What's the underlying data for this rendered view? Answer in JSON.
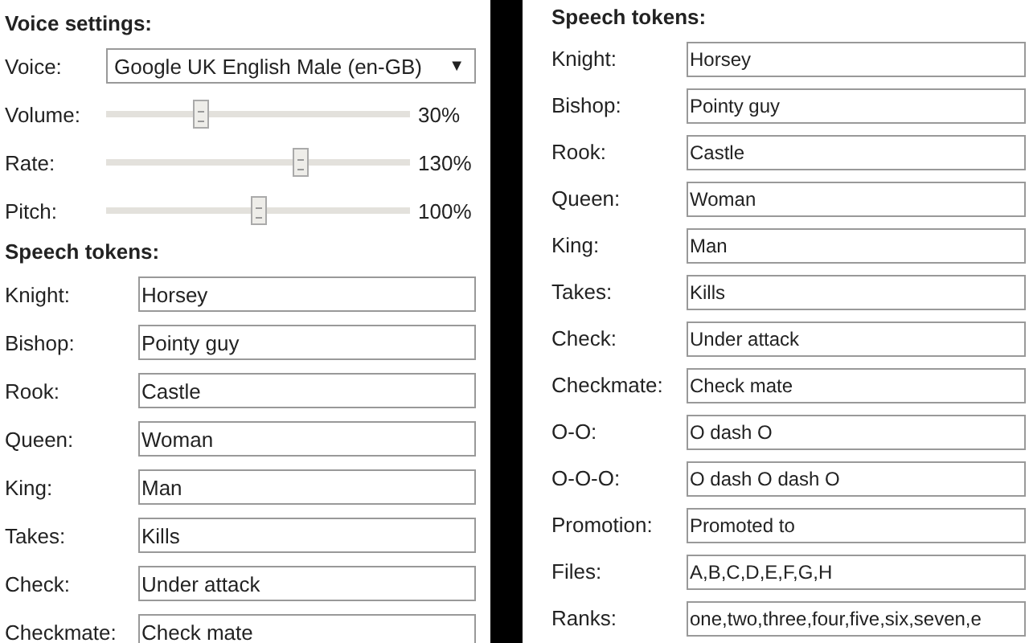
{
  "left_panel": {
    "voice_settings": {
      "heading": "Voice settings:",
      "voice": {
        "label": "Voice:",
        "value": "Google UK English Male (en-GB)",
        "arrow": "▼"
      },
      "sliders": [
        {
          "label": "Volume:",
          "level": 0.31,
          "reading": "30%"
        },
        {
          "label": "Rate:",
          "level": 0.64,
          "reading": "130%"
        },
        {
          "label": "Pitch:",
          "level": 0.5,
          "reading": "100%"
        }
      ]
    },
    "speech_tokens": {
      "heading": "Speech tokens:",
      "tokens": [
        {
          "label": "Knight:",
          "value": "Horsey"
        },
        {
          "label": "Bishop:",
          "value": "Pointy guy"
        },
        {
          "label": "Rook:",
          "value": "Castle"
        },
        {
          "label": "Queen:",
          "value": "Woman"
        },
        {
          "label": "King:",
          "value": "Man"
        },
        {
          "label": "Takes:",
          "value": "Kills"
        },
        {
          "label": "Check:",
          "value": "Under attack"
        },
        {
          "label": "Checkmate:",
          "value": "Check mate"
        }
      ]
    }
  },
  "right_panel": {
    "speech_tokens": {
      "heading": "Speech tokens:",
      "tokens": [
        {
          "label": "Knight:",
          "value": "Horsey"
        },
        {
          "label": "Bishop:",
          "value": "Pointy guy"
        },
        {
          "label": "Rook:",
          "value": "Castle"
        },
        {
          "label": "Queen:",
          "value": "Woman"
        },
        {
          "label": "King:",
          "value": "Man"
        },
        {
          "label": "Takes:",
          "value": "Kills"
        },
        {
          "label": "Check:",
          "value": "Under attack"
        },
        {
          "label": "Checkmate:",
          "value": "Check mate"
        },
        {
          "label": "O-O:",
          "value": "O dash O"
        },
        {
          "label": "O-O-O:",
          "value": "O dash O dash O"
        },
        {
          "label": "Promotion:",
          "value": "Promoted to"
        },
        {
          "label": "Files:",
          "value": "A,B,C,D,E,F,G,H"
        },
        {
          "label": "Ranks:",
          "value": "one,two,three,four,five,six,seven,e"
        }
      ]
    }
  }
}
